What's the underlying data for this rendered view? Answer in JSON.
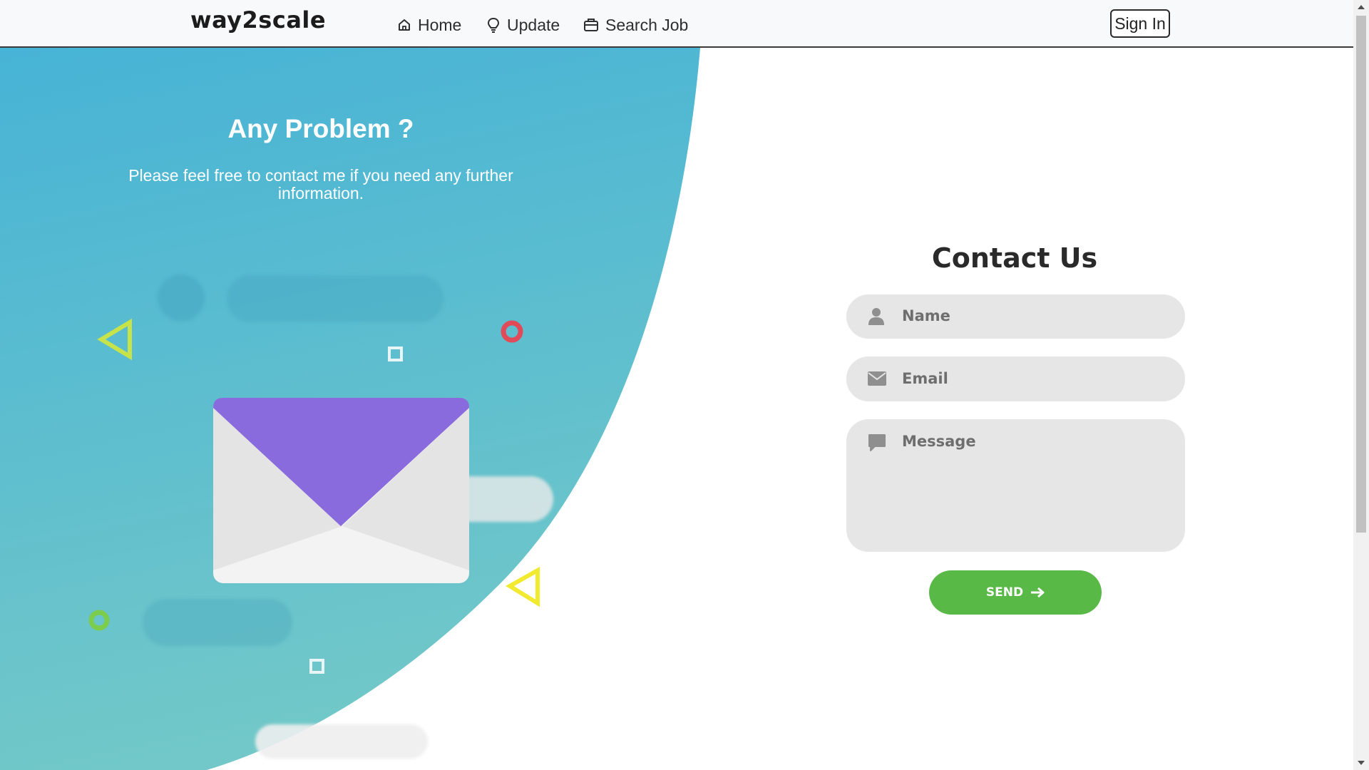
{
  "navbar": {
    "brand": "way2scale",
    "items": [
      {
        "label": "Home",
        "icon": "home-icon"
      },
      {
        "label": "Update",
        "icon": "lightbulb-icon"
      },
      {
        "label": "Search Job",
        "icon": "briefcase-icon"
      }
    ],
    "signin_label": "Sign In"
  },
  "hero": {
    "title": "Any Problem ?",
    "subtitle_line1": "Please feel free to contact me if you need any further",
    "subtitle_line2": "information."
  },
  "contact": {
    "title": "Contact Us",
    "name_placeholder": "Name",
    "email_placeholder": "Email",
    "message_placeholder": "Message",
    "send_label": "SEND"
  },
  "colors": {
    "gradient_top": "#47b3d6",
    "gradient_bottom": "#72c8c8",
    "envelope_flap": "#8a6bdd",
    "send_button": "#58b947",
    "field_bg": "#e6e6e6"
  }
}
